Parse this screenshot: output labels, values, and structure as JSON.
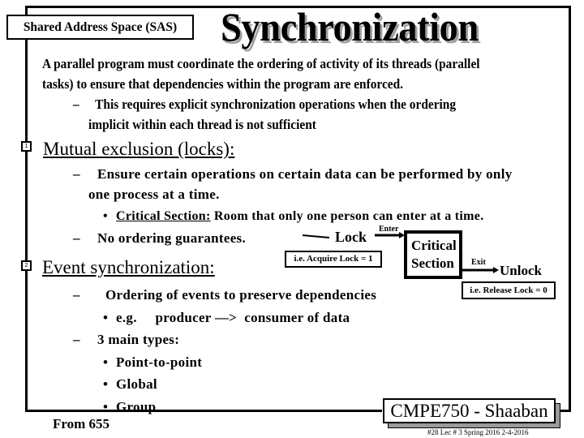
{
  "header": {
    "section_label": "Shared Address Space (SAS)",
    "title": "Synchronization"
  },
  "intro": {
    "line1": "A parallel program must coordinate the ordering of activity of  its threads (parallel",
    "line2": "tasks) to ensure that dependencies within the program are enforced.",
    "sub_dash": "–",
    "sub_line1": "This requires explicit synchronization operations when the ordering",
    "sub_line2": "implicit within each thread is not sufficient"
  },
  "mutex": {
    "badge": "1",
    "heading": "Mutual exclusion (locks):",
    "dash": "–",
    "point_line1": "Ensure certain operations on certain data can be performed by only",
    "point_line2": "one process at a time.",
    "bullet": "•",
    "critical_term": "Critical Section:",
    "critical_def": " Room that only one person can enter at a time.",
    "no_ordering": "No ordering guarantees."
  },
  "diagram": {
    "lock_label": "Lock",
    "enter_label": "Enter",
    "critical_section_line1": "Critical",
    "critical_section_line2": "Section",
    "exit_label": "Exit",
    "unlock_label": "Unlock",
    "acquire_note": "i.e. Acquire Lock = 1",
    "release_note": "i.e. Release Lock = 0"
  },
  "event": {
    "badge": "2",
    "heading": "Event synchronization:",
    "dash": "–",
    "point1": "Ordering of events to preserve dependencies",
    "bullet": "•",
    "example": "e.g.     producer —>  consumer of data",
    "point2": "3 main types:",
    "types": [
      "Point-to-point",
      "Global",
      "Group"
    ]
  },
  "footer": {
    "source": "From 655",
    "course": "CMPE750 - Shaaban",
    "meta": "#28   Lec # 3   Spring 2016  2-4-2016"
  }
}
